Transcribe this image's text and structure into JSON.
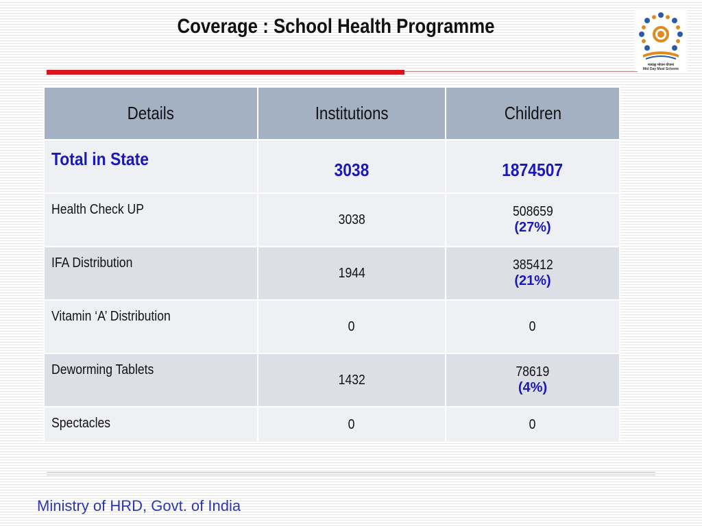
{
  "title": "Coverage : School Health Programme",
  "logo": {
    "caption_hindi": "मध्याह्न भोजन योजना",
    "caption_english": "Mid Day Meal Scheme"
  },
  "table": {
    "headers": [
      "Details",
      "Institutions",
      "Children"
    ],
    "total": {
      "label": "Total in State",
      "institutions": "3038",
      "children": "1874507"
    },
    "rows": [
      {
        "label": "Health Check UP",
        "institutions": "3038",
        "children": "508659",
        "pct": "(27%)"
      },
      {
        "label": "IFA Distribution",
        "institutions": "1944",
        "children": "385412",
        "pct": "(21%)"
      },
      {
        "label": "Vitamin ‘A’ Distribution",
        "institutions": "0",
        "children": "0",
        "pct": ""
      },
      {
        "label": "Deworming Tablets",
        "institutions": "1432",
        "children": "78619",
        "pct": "(4%)"
      },
      {
        "label": "Spectacles",
        "institutions": "0",
        "children": "0",
        "pct": ""
      }
    ]
  },
  "footer": "Ministry of HRD, Govt. of India",
  "colors": {
    "accent_red": "#d9141a",
    "header_bg": "#a4b1c3",
    "blue_text": "#1a18b8"
  }
}
